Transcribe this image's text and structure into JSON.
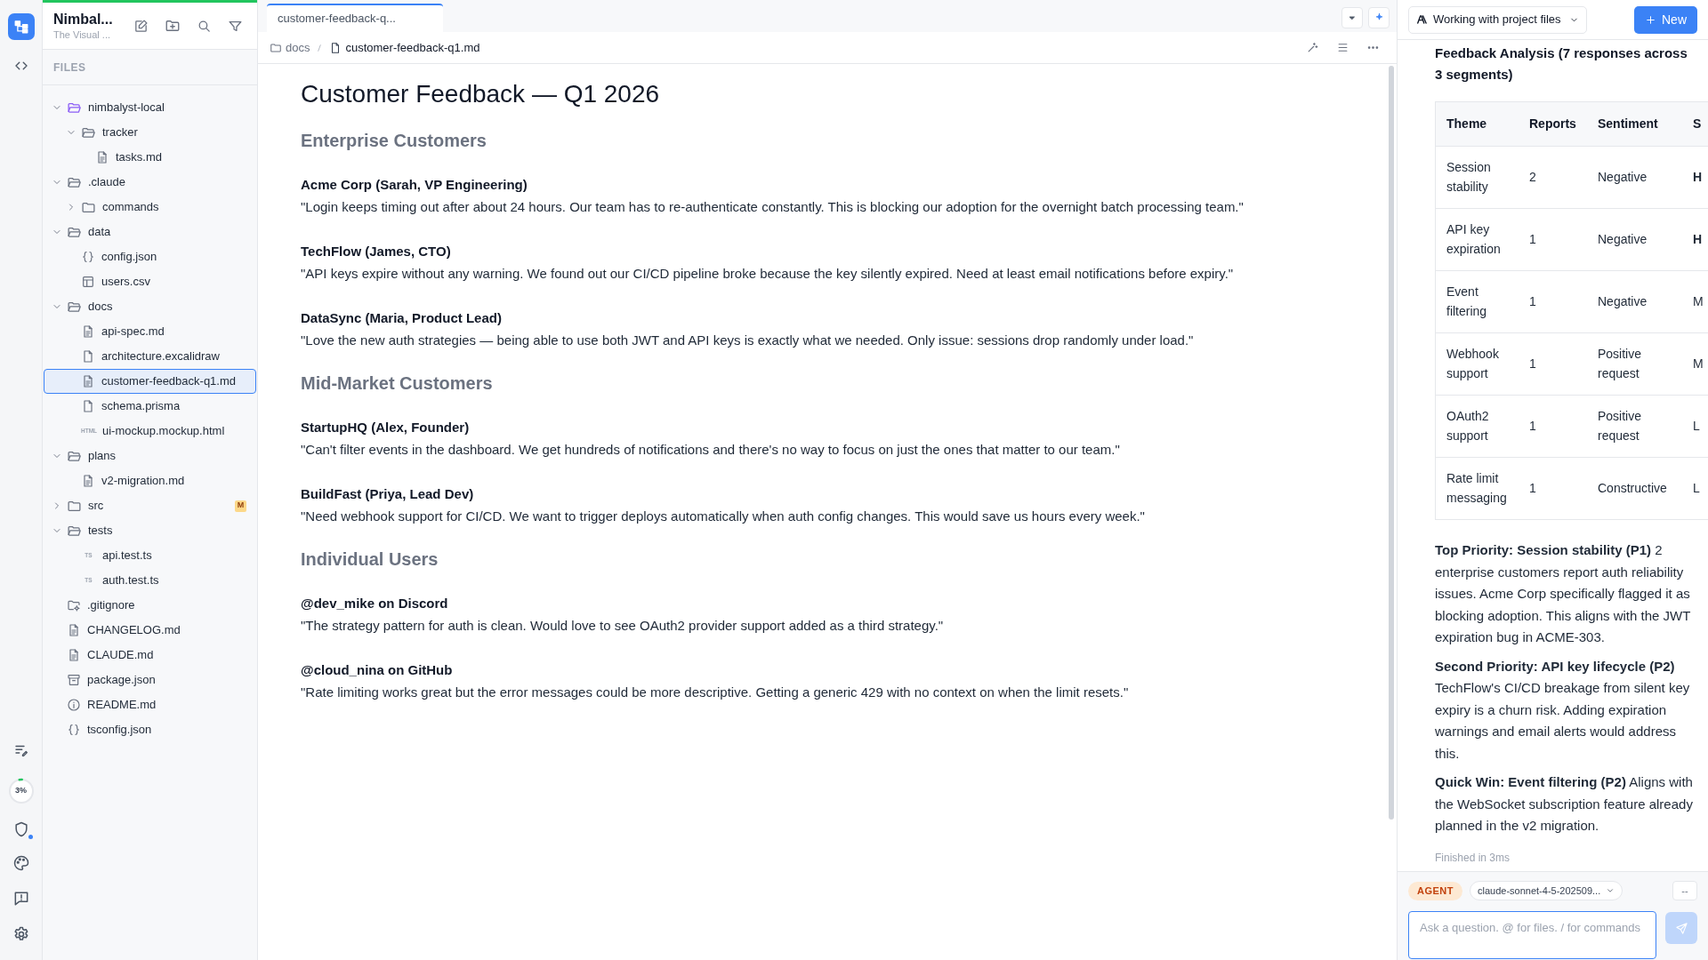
{
  "rail": {
    "usage": {
      "label": "3%",
      "level": 0.03
    },
    "shield_alert": true
  },
  "sidebar": {
    "title": "Nimbal...",
    "subtitle": "The Visual ...",
    "section_label": "FILES",
    "tree": [
      {
        "label": "nimbalyst-local",
        "kind": "root",
        "expanded": true,
        "selected": false,
        "children": [
          {
            "label": "tracker",
            "kind": "folder",
            "expanded": true,
            "selected": false,
            "children": [
              {
                "label": "tasks.md",
                "kind": "doc",
                "selected": false
              }
            ]
          }
        ]
      },
      {
        "label": ".claude",
        "kind": "folder",
        "expanded": true,
        "selected": false,
        "children": [
          {
            "label": "commands",
            "kind": "folder",
            "expanded": false,
            "selected": false
          }
        ]
      },
      {
        "label": "data",
        "kind": "folder",
        "expanded": true,
        "selected": false,
        "children": [
          {
            "label": "config.json",
            "kind": "braces",
            "selected": false
          },
          {
            "label": "users.csv",
            "kind": "table",
            "selected": false
          }
        ]
      },
      {
        "label": "docs",
        "kind": "folder",
        "expanded": true,
        "selected": false,
        "children": [
          {
            "label": "api-spec.md",
            "kind": "doc",
            "selected": false
          },
          {
            "label": "architecture.excalidraw",
            "kind": "file",
            "selected": false
          },
          {
            "label": "customer-feedback-q1.md",
            "kind": "doc",
            "selected": true
          },
          {
            "label": "schema.prisma",
            "kind": "file",
            "selected": false
          },
          {
            "label": "ui-mockup.mockup.html",
            "kind": "tag",
            "tag": "HTML",
            "selected": false
          }
        ]
      },
      {
        "label": "plans",
        "kind": "folder",
        "expanded": true,
        "selected": false,
        "children": [
          {
            "label": "v2-migration.md",
            "kind": "doc",
            "selected": false
          }
        ]
      },
      {
        "label": "src",
        "kind": "folder",
        "expanded": false,
        "selected": false,
        "status": "M"
      },
      {
        "label": "tests",
        "kind": "folder",
        "expanded": true,
        "selected": false,
        "children": [
          {
            "label": "api.test.ts",
            "kind": "tag",
            "tag": "TS",
            "selected": false
          },
          {
            "label": "auth.test.ts",
            "kind": "tag",
            "tag": "TS",
            "selected": false
          }
        ]
      },
      {
        "label": ".gitignore",
        "kind": "gearfolder",
        "selected": false
      },
      {
        "label": "CHANGELOG.md",
        "kind": "doc",
        "selected": false
      },
      {
        "label": "CLAUDE.md",
        "kind": "doc",
        "selected": false
      },
      {
        "label": "package.json",
        "kind": "archive",
        "selected": false
      },
      {
        "label": "README.md",
        "kind": "info",
        "selected": false
      },
      {
        "label": "tsconfig.json",
        "kind": "braces",
        "selected": false
      }
    ]
  },
  "editor": {
    "tabs": [
      {
        "label": "customer-feedback-q...",
        "selected": true
      }
    ],
    "breadcrumb": [
      "docs",
      "customer-feedback-q1.md"
    ],
    "document": {
      "title": "Customer Feedback — Q1 2026",
      "sections": [
        {
          "heading": "Enterprise Customers",
          "entries": [
            {
              "author": "Acme Corp (Sarah, VP Engineering)",
              "quote": "\"Login keeps timing out after about 24 hours. Our team has to re-authenticate constantly. This is blocking our adoption for the overnight batch processing team.\""
            },
            {
              "author": "TechFlow (James, CTO)",
              "quote": "\"API keys expire without any warning. We found out our CI/CD pipeline broke because the key silently expired. Need at least email notifications before expiry.\""
            },
            {
              "author": "DataSync (Maria, Product Lead)",
              "quote": "\"Love the new auth strategies — being able to use both JWT and API keys is exactly what we needed. Only issue: sessions drop randomly under load.\""
            }
          ]
        },
        {
          "heading": "Mid-Market Customers",
          "entries": [
            {
              "author": "StartupHQ (Alex, Founder)",
              "quote": "\"Can't filter events in the dashboard. We get hundreds of notifications and there's no way to focus on just the ones that matter to our team.\""
            },
            {
              "author": "BuildFast (Priya, Lead Dev)",
              "quote": "\"Need webhook support for CI/CD. We want to trigger deploys automatically when auth config changes. This would save us hours every week.\""
            }
          ]
        },
        {
          "heading": "Individual Users",
          "entries": [
            {
              "author": "@dev_mike on Discord",
              "quote": "\"The strategy pattern for auth is clean. Would love to see OAuth2 provider support added as a third strategy.\""
            },
            {
              "author": "@cloud_nina on GitHub",
              "quote": "\"Rate limiting works great but the error messages could be more descriptive. Getting a generic 429 with no context on when the limit resets.\""
            }
          ]
        }
      ]
    }
  },
  "agent_panel": {
    "mode": "Working with project files",
    "new_button": "New",
    "heading": "Feedback Analysis (7 responses across 3 segments)",
    "table": {
      "columns": [
        "Theme",
        "Reports",
        "Sentiment",
        "S"
      ],
      "rows": [
        [
          "Session stability",
          "2",
          "Negative",
          "H"
        ],
        [
          "API key expiration",
          "1",
          "Negative",
          "H"
        ],
        [
          "Event filtering",
          "1",
          "Negative",
          "M"
        ],
        [
          "Webhook support",
          "1",
          "Positive request",
          "M"
        ],
        [
          "OAuth2 support",
          "1",
          "Positive request",
          "L"
        ],
        [
          "Rate limit messaging",
          "1",
          "Constructive",
          "L"
        ]
      ]
    },
    "paragraphs": [
      "**Top Priority: Session stability (P1)** 2 enterprise customers report auth reliability issues. Acme Corp specifically flagged it as blocking adoption. This aligns with the JWT expiration bug in ACME-303.",
      "**Second Priority: API key lifecycle (P2)** TechFlow's CI/CD breakage from silent key expiry is a churn risk. Adding expiration warnings and email alerts would address this.",
      "**Quick Win: Event filtering (P2)** Aligns with the WebSocket subscription feature already planned in the v2 migration."
    ],
    "status": "Finished in 3ms",
    "composer": {
      "mode_badge": "AGENT",
      "model": "claude-sonnet-4-5-202509...",
      "extra_button": "--",
      "placeholder": "Ask a question. @ for files. / for commands"
    }
  }
}
